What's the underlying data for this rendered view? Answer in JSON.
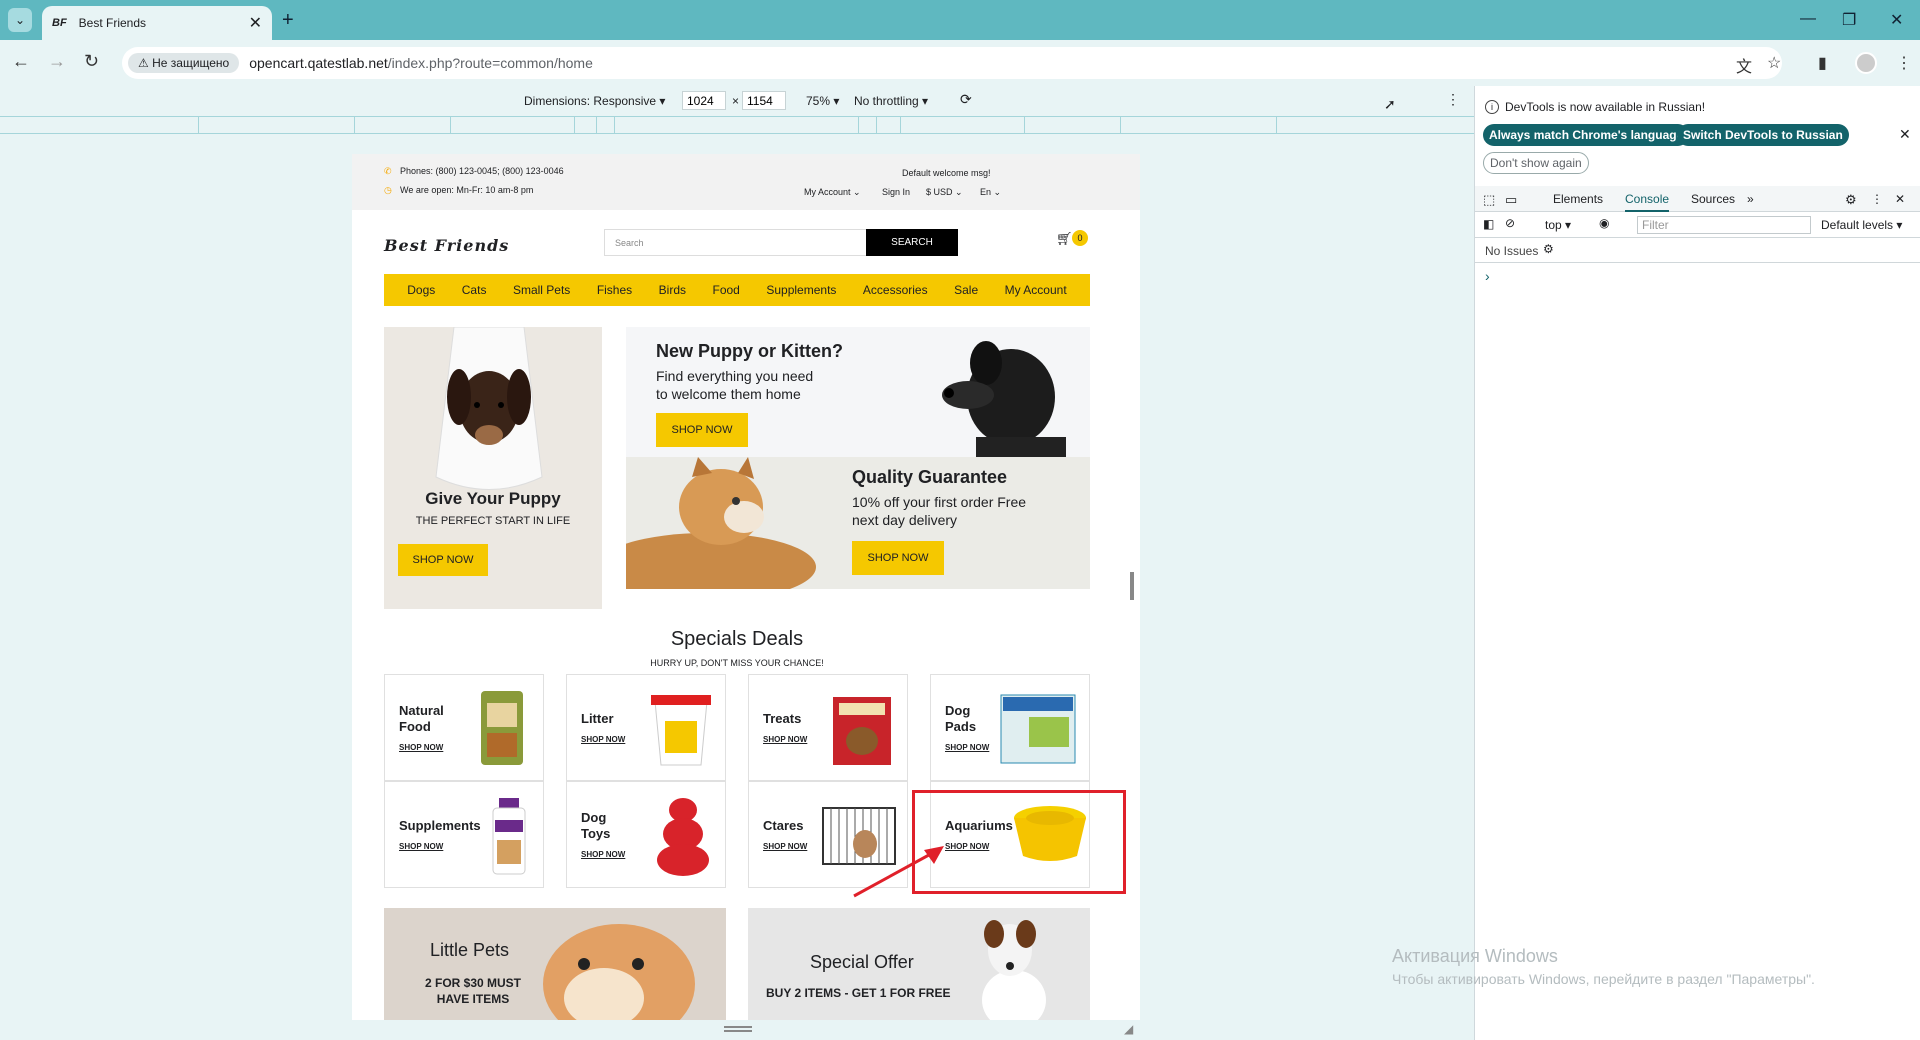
{
  "browser": {
    "tab_title": "Best Friends",
    "tab_favicon": "BF",
    "insecure_label": "Не защищено",
    "url_host": "opencart.qatestlab.net",
    "url_path": "/index.php?route=common/home"
  },
  "devbar": {
    "dimensions": "Dimensions: Responsive",
    "width": "1024",
    "x": "×",
    "height": "1154",
    "zoom": "75%",
    "throttle": "No throttling"
  },
  "site": {
    "phones": "Phones: (800) 123-0045; (800) 123-0046",
    "hours": "We are open: Mn-Fr: 10 am-8 pm",
    "welcome": "Default welcome msg!",
    "my_account": "My Account",
    "sign_in": "Sign In",
    "currency": "$ USD",
    "lang": "En",
    "logo": "Best Friends",
    "search_placeholder": "Search",
    "search_button": "SEARCH",
    "cart_count": "0",
    "menu": [
      "Dogs",
      "Cats",
      "Small Pets",
      "Fishes",
      "Birds",
      "Food",
      "Supplements",
      "Accessories",
      "Sale",
      "My Account"
    ],
    "banner_left": {
      "title": "Give Your Puppy",
      "subtitle": "THE PERFECT START IN LIFE",
      "button": "SHOP NOW"
    },
    "banner_top": {
      "title": "New Puppy or Kitten?",
      "text1": "Find everything you need",
      "text2": "to welcome them home",
      "button": "SHOP NOW"
    },
    "banner_bottom": {
      "title": "Quality Guarantee",
      "text1": "10% off your first order Free",
      "text2": "next day delivery",
      "button": "SHOP NOW"
    },
    "deals_title": "Specials Deals",
    "deals_sub": "HURRY UP, DON'T MISS YOUR CHANCE!",
    "deals": [
      {
        "l1": "Natural",
        "l2": "Food",
        "shop": "SHOP NOW"
      },
      {
        "l1": "Litter",
        "l2": "",
        "shop": "SHOP NOW"
      },
      {
        "l1": "Treats",
        "l2": "",
        "shop": "SHOP NOW"
      },
      {
        "l1": "Dog",
        "l2": "Pads",
        "shop": "SHOP NOW"
      },
      {
        "l1": "Supplements",
        "l2": "",
        "shop": "SHOP NOW"
      },
      {
        "l1": "Dog",
        "l2": "Toys",
        "shop": "SHOP NOW"
      },
      {
        "l1": "Ctares",
        "l2": "",
        "shop": "SHOP NOW"
      },
      {
        "l1": "Aquariums",
        "l2": "",
        "shop": "SHOP NOW"
      }
    ],
    "little_pets": {
      "title": "Little Pets",
      "text1": "2 FOR $30 MUST",
      "text2": "HAVE ITEMS"
    },
    "special_offer": {
      "title": "Special Offer",
      "text": "BUY 2 ITEMS - GET 1 FOR FREE"
    }
  },
  "devtools": {
    "info": "DevTools is now available in Russian!",
    "btn_match": "Always match Chrome's language",
    "btn_switch": "Switch DevTools to Russian",
    "btn_dont": "Don't show again",
    "tabs": [
      "Elements",
      "Console",
      "Sources"
    ],
    "context": "top",
    "filter_placeholder": "Filter",
    "levels": "Default levels",
    "issues": "No Issues",
    "prompt": "›"
  },
  "watermark": {
    "line1": "Активация Windows",
    "line2": "Чтобы активировать Windows, перейдите в раздел \"Параметры\"."
  },
  "colors": {
    "accent": "#f5c800",
    "chrome": "#5fb8c0",
    "highlight": "#e0202a"
  }
}
